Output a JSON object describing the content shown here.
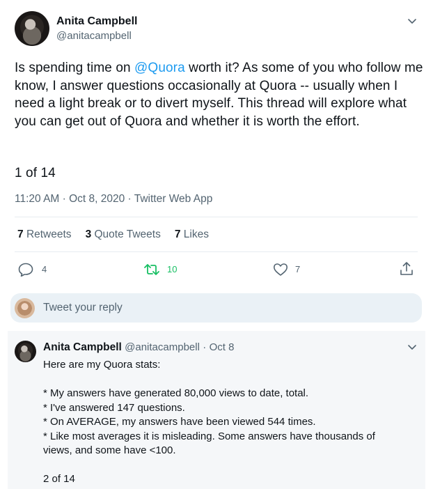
{
  "tweet": {
    "author_name": "Anita Campbell",
    "author_handle": "@anitacampbell",
    "text_before_mention": "Is spending time on ",
    "mention": "@Quora",
    "text_after_mention": " worth it? As some of you who follow me know, I answer questions occasionally at Quora -- usually when I need a light break or to divert myself.  This thread will explore what you can get out of  Quora and whether it is worth the effort.",
    "counter": "1 of 14",
    "timestamp": "11:20 AM · Oct 8, 2020 · Twitter Web App",
    "retweets_count": "7",
    "retweets_label": "Retweets",
    "quote_tweets_count": "3",
    "quote_tweets_label": "Quote Tweets",
    "likes_count": "7",
    "likes_label": "Likes",
    "actions": {
      "reply_count": "4",
      "retweet_count": "10",
      "like_count": "7"
    },
    "accent_retweet_color": "#17bf63"
  },
  "reply_composer": {
    "placeholder": "Tweet your reply"
  },
  "reply": {
    "author_name": "Anita Campbell",
    "author_handle": "@anitacampbell",
    "date": "Oct 8",
    "lines": [
      "Here are my Quora stats:",
      "",
      "* My answers have generated 80,000 views to date, total.",
      "* I've answered 147 questions.",
      "* On AVERAGE, my answers have been viewed 544 times.",
      "* Like most averages it is misleading. Some answers have thousands of",
      "views, and some have <100.",
      "",
      "2 of 14"
    ]
  },
  "icons": [
    "chevron-down-icon",
    "reply-icon",
    "retweet-icon",
    "like-icon",
    "share-icon"
  ]
}
